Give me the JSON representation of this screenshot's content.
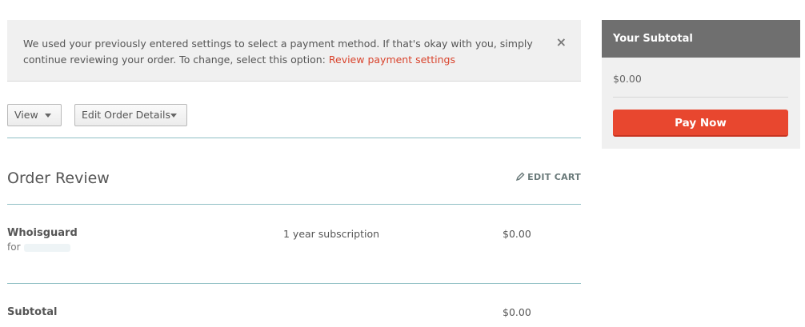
{
  "notice": {
    "text": "We used your previously entered settings to select a payment method. If that's okay with you, simply continue reviewing your order. To change, select this option: ",
    "link": "Review payment settings",
    "close": "×"
  },
  "toolbar": {
    "view_label": "View",
    "edit_order_label": "Edit Order Details"
  },
  "review": {
    "title": "Order Review",
    "edit_cart": "EDIT CART",
    "items": [
      {
        "name": "Whoisguard",
        "for_label": "for",
        "description": "1 year subscription",
        "price": "$0.00"
      }
    ],
    "subtotal_label": "Subtotal",
    "subtotal_value": "$0.00"
  },
  "sidebar": {
    "title": "Your Subtotal",
    "amount": "$0.00",
    "pay_label": "Pay Now"
  },
  "colors": {
    "accent": "#e8472f",
    "link": "#d9432c",
    "rule": "#8fbfc4"
  }
}
